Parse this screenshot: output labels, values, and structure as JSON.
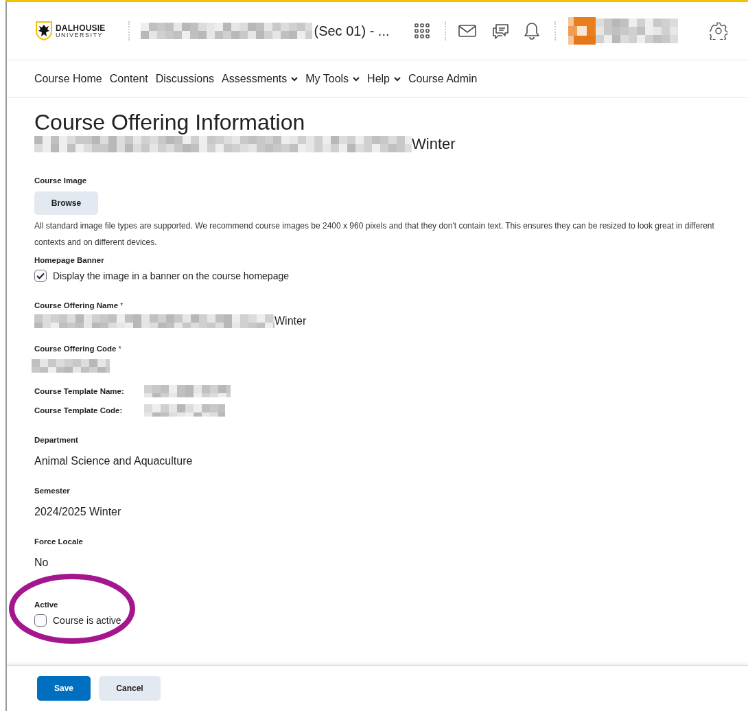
{
  "header": {
    "logo": {
      "name": "DALHOUSIE",
      "sub": "UNIVERSITY"
    },
    "course_title": "(Sec 01) - ..."
  },
  "nav": [
    {
      "label": "Course Home",
      "menu": false
    },
    {
      "label": "Content",
      "menu": false
    },
    {
      "label": "Discussions",
      "menu": false
    },
    {
      "label": "Assessments",
      "menu": true
    },
    {
      "label": "My Tools",
      "menu": true
    },
    {
      "label": "Help",
      "menu": true
    },
    {
      "label": "Course Admin",
      "menu": false
    }
  ],
  "page": {
    "title": "Course Offering Information",
    "subtitle": "Winter"
  },
  "course_image": {
    "label": "Course Image",
    "button": "Browse",
    "help": "All standard image file types are supported. We recommend course images be 2400 x 960 pixels and that they don't contain text. This ensures they can be resized to look great in different contexts and on different devices."
  },
  "homepage_banner": {
    "label": "Homepage Banner",
    "option": "Display the image in a banner on the course homepage",
    "checked": true
  },
  "offering_name": {
    "label": "Course Offering Name",
    "required_mark": "*",
    "value": "Winter"
  },
  "offering_code": {
    "label": "Course Offering Code",
    "required_mark": "*"
  },
  "template": [
    {
      "label": "Course Template Name:"
    },
    {
      "label": "Course Template Code:"
    }
  ],
  "info": [
    {
      "label": "Department",
      "value": "Animal Science and Aquaculture"
    },
    {
      "label": "Semester",
      "value": "2024/2025 Winter"
    },
    {
      "label": "Force Locale",
      "value": "No"
    }
  ],
  "active": {
    "label": "Active",
    "option": "Course is active",
    "checked": false
  },
  "buttons": [
    {
      "label": "Save",
      "kind": "primary"
    },
    {
      "label": "Cancel",
      "kind": "secondary"
    }
  ]
}
